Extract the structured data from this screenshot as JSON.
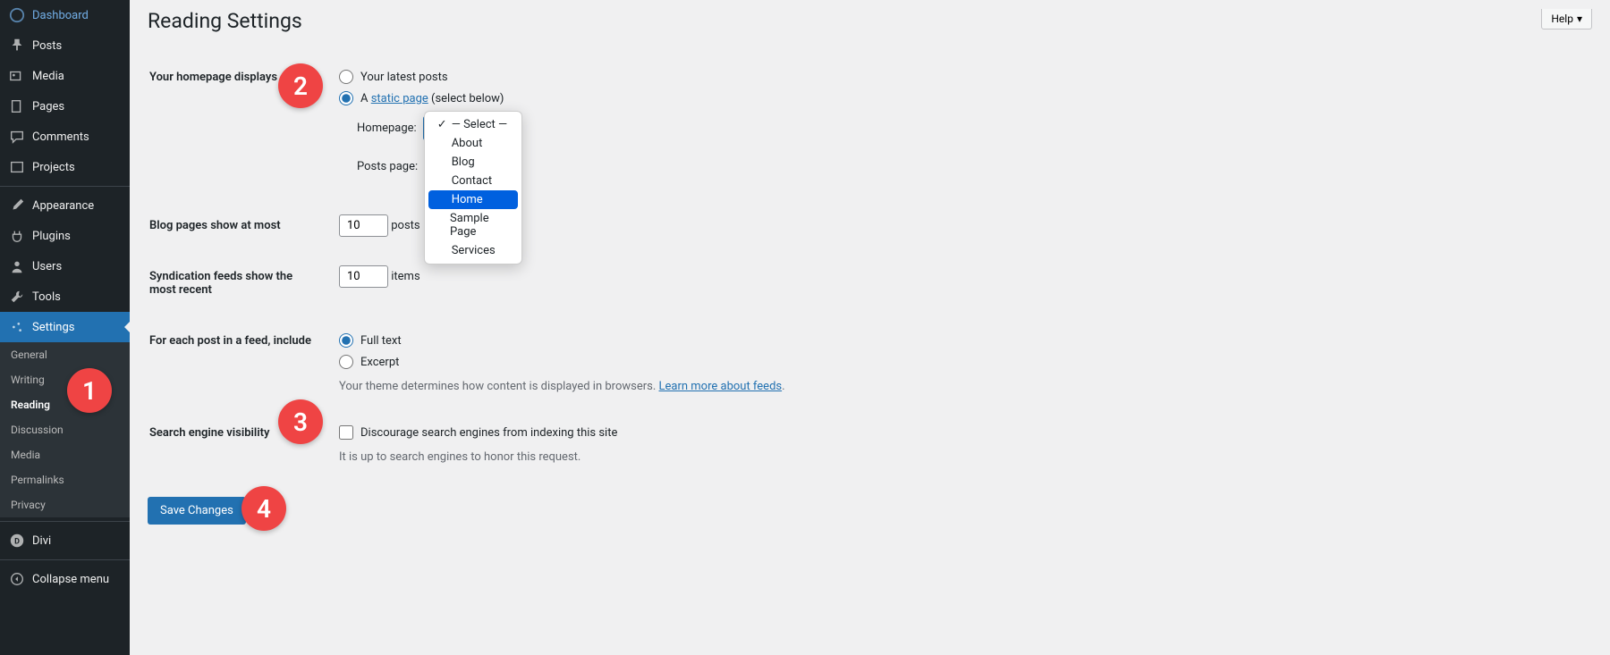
{
  "sidebar": {
    "items": [
      {
        "label": "Dashboard",
        "icon": "dashboard"
      },
      {
        "label": "Posts",
        "icon": "pin"
      },
      {
        "label": "Media",
        "icon": "media"
      },
      {
        "label": "Pages",
        "icon": "pages"
      },
      {
        "label": "Comments",
        "icon": "comment"
      },
      {
        "label": "Projects",
        "icon": "projects"
      },
      {
        "label": "Appearance",
        "icon": "brush"
      },
      {
        "label": "Plugins",
        "icon": "plug"
      },
      {
        "label": "Users",
        "icon": "user"
      },
      {
        "label": "Tools",
        "icon": "wrench"
      },
      {
        "label": "Settings",
        "icon": "settings"
      }
    ],
    "sub": [
      "General",
      "Writing",
      "Reading",
      "Discussion",
      "Media",
      "Permalinks",
      "Privacy"
    ],
    "divi": "Divi",
    "collapse": "Collapse menu"
  },
  "header": {
    "title": "Reading Settings",
    "help": "Help"
  },
  "form": {
    "homepage_displays": {
      "label": "Your homepage displays",
      "opt_latest": "Your latest posts",
      "opt_static_a": "A ",
      "opt_static_link": "static page",
      "opt_static_b": " (select below)",
      "homepage_label": "Homepage:",
      "posts_page_label": "Posts page:",
      "homepage_value": "— Select —",
      "posts_page_value": "— Select —"
    },
    "dropdown": {
      "items": [
        "— Select —",
        "About",
        "Blog",
        "Contact",
        "Home",
        "Sample Page",
        "Services"
      ],
      "selected_idx": 0,
      "highlight_idx": 4
    },
    "blog_pages": {
      "label": "Blog pages show at most",
      "value": "10",
      "suffix": "posts"
    },
    "syndication": {
      "label": "Syndication feeds show the most recent",
      "value": "10",
      "suffix": "items"
    },
    "feed_content": {
      "label": "For each post in a feed, include",
      "opt_full": "Full text",
      "opt_excerpt": "Excerpt",
      "desc_a": "Your theme determines how content is displayed in browsers. ",
      "desc_link": "Learn more about feeds",
      "desc_b": "."
    },
    "seo": {
      "label": "Search engine visibility",
      "checkbox": "Discourage search engines from indexing this site",
      "note": "It is up to search engines to honor this request."
    },
    "save": "Save Changes"
  },
  "annotations": {
    "a1": "1",
    "a2": "2",
    "a3": "3",
    "a4": "4"
  }
}
